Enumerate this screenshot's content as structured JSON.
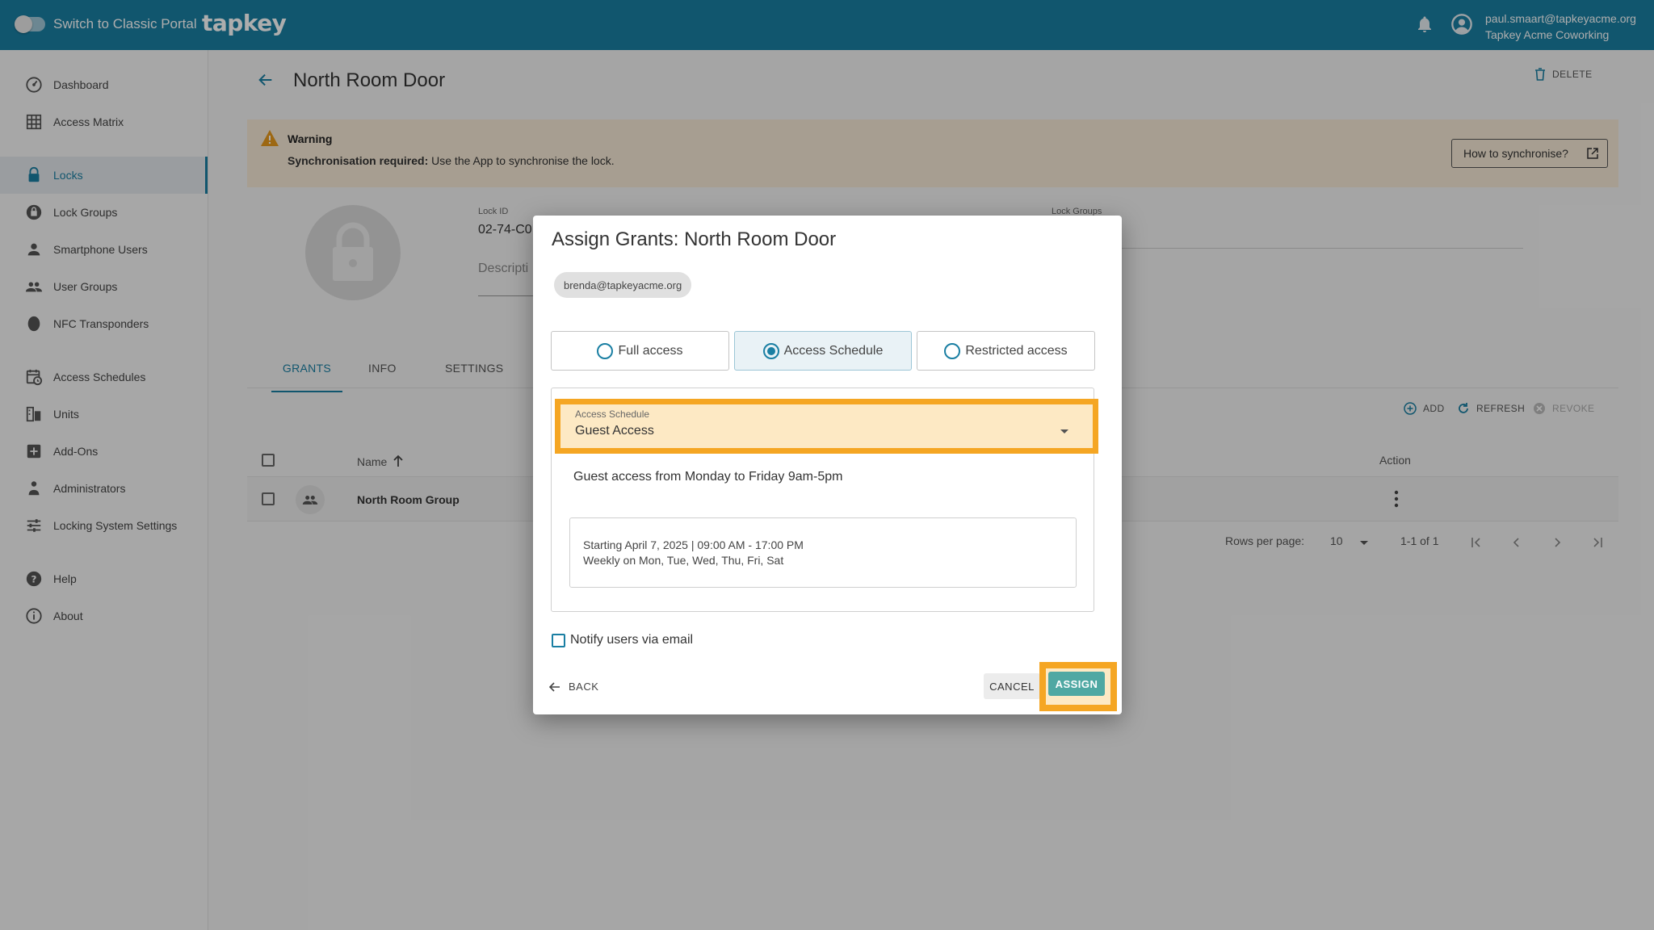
{
  "topbar": {
    "classic_label": "Switch to Classic Portal",
    "logo": "tapkey",
    "user_email": "paul.smaart@tapkeyacme.org",
    "user_org": "Tapkey Acme Coworking"
  },
  "sidebar": {
    "items": [
      {
        "label": "Dashboard",
        "icon": "dashboard-icon"
      },
      {
        "label": "Access Matrix",
        "icon": "grid-icon"
      },
      {
        "label": "Locks",
        "icon": "lock-icon",
        "active": true
      },
      {
        "label": "Lock Groups",
        "icon": "lock-group-icon"
      },
      {
        "label": "Smartphone Users",
        "icon": "person-icon"
      },
      {
        "label": "User Groups",
        "icon": "people-icon"
      },
      {
        "label": "NFC Transponders",
        "icon": "transponder-icon"
      },
      {
        "label": "Access Schedules",
        "icon": "calendar-clock-icon"
      },
      {
        "label": "Units",
        "icon": "units-icon"
      },
      {
        "label": "Add-Ons",
        "icon": "add-box-icon"
      },
      {
        "label": "Administrators",
        "icon": "admin-icon"
      },
      {
        "label": "Locking System Settings",
        "icon": "sliders-icon"
      },
      {
        "label": "Help",
        "icon": "help-icon"
      },
      {
        "label": "About",
        "icon": "info-icon"
      }
    ]
  },
  "page": {
    "title": "North Room Door",
    "delete_label": "DELETE",
    "warning": {
      "title": "Warning",
      "bold": "Synchronisation required:",
      "text": " Use the App to synchronise the lock.",
      "button": "How to synchronise?"
    },
    "lock_id_label": "Lock ID",
    "lock_id_value": "02-74-C0",
    "description_label": "Descripti",
    "lock_groups_label": "Lock Groups",
    "tabs": [
      "GRANTS",
      "INFO",
      "SETTINGS"
    ],
    "actions": {
      "add": "ADD",
      "refresh": "REFRESH",
      "revoke": "REVOKE"
    },
    "table": {
      "col_name": "Name",
      "col_action": "Action",
      "rows": [
        {
          "name": "North Room Group"
        }
      ]
    },
    "pagination": {
      "rows_per_page_label": "Rows per page:",
      "rows_per_page": "10",
      "range": "1-1 of 1"
    }
  },
  "dialog": {
    "title": "Assign Grants: North Room Door",
    "chip": "brenda@tapkeyacme.org",
    "options": [
      "Full access",
      "Access Schedule",
      "Restricted access"
    ],
    "selected_option": "Access Schedule",
    "schedule_label": "Access Schedule",
    "schedule_value": "Guest Access",
    "schedule_desc": "Guest access from Monday to Friday 9am-5pm",
    "recurrence_line1": "Starting April 7, 2025 | 09:00 AM - 17:00 PM",
    "recurrence_line2": "Weekly on Mon, Tue, Wed, Thu, Fri, Sat",
    "notify_label": "Notify users via email",
    "back": "BACK",
    "cancel": "CANCEL",
    "assign": "ASSIGN"
  },
  "colors": {
    "primary": "#1a7fa3",
    "highlight": "#f5a623",
    "assign": "#4fa8a3",
    "warning_bg": "#f6e9d6"
  }
}
